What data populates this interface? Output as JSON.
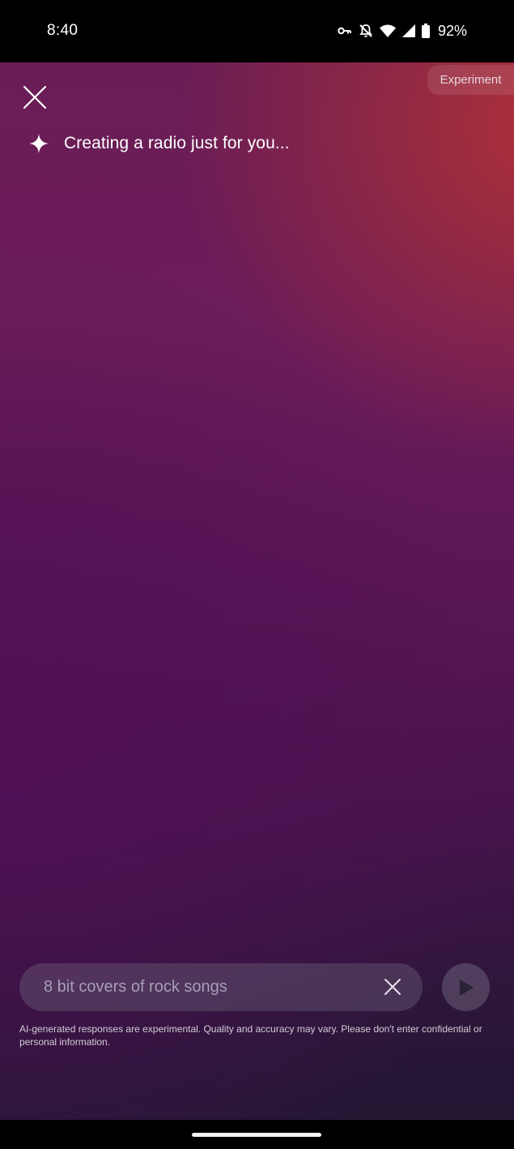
{
  "status_bar": {
    "time": "8:40",
    "icons": [
      "vpn-key-icon",
      "mute-icon",
      "wifi-icon",
      "signal-icon",
      "battery-icon"
    ],
    "battery_percent": "92%"
  },
  "header": {
    "experiment_badge": "Experiment",
    "close_icon": "close-icon"
  },
  "main": {
    "status_icon": "sparkle-icon",
    "status_text": "Creating a radio just for you..."
  },
  "prompt": {
    "value": "8 bit covers of rock songs",
    "clear_icon": "clear-icon",
    "submit_icon": "play-icon"
  },
  "disclaimer": "AI-generated responses are experimental. Quality and accuracy may vary. Please don't enter confidential or personal information.",
  "colors": {
    "gradient_top_right": "#b43237",
    "gradient_mid": "#6c1c5a",
    "gradient_bottom": "#231734",
    "text": "#ffffff"
  }
}
